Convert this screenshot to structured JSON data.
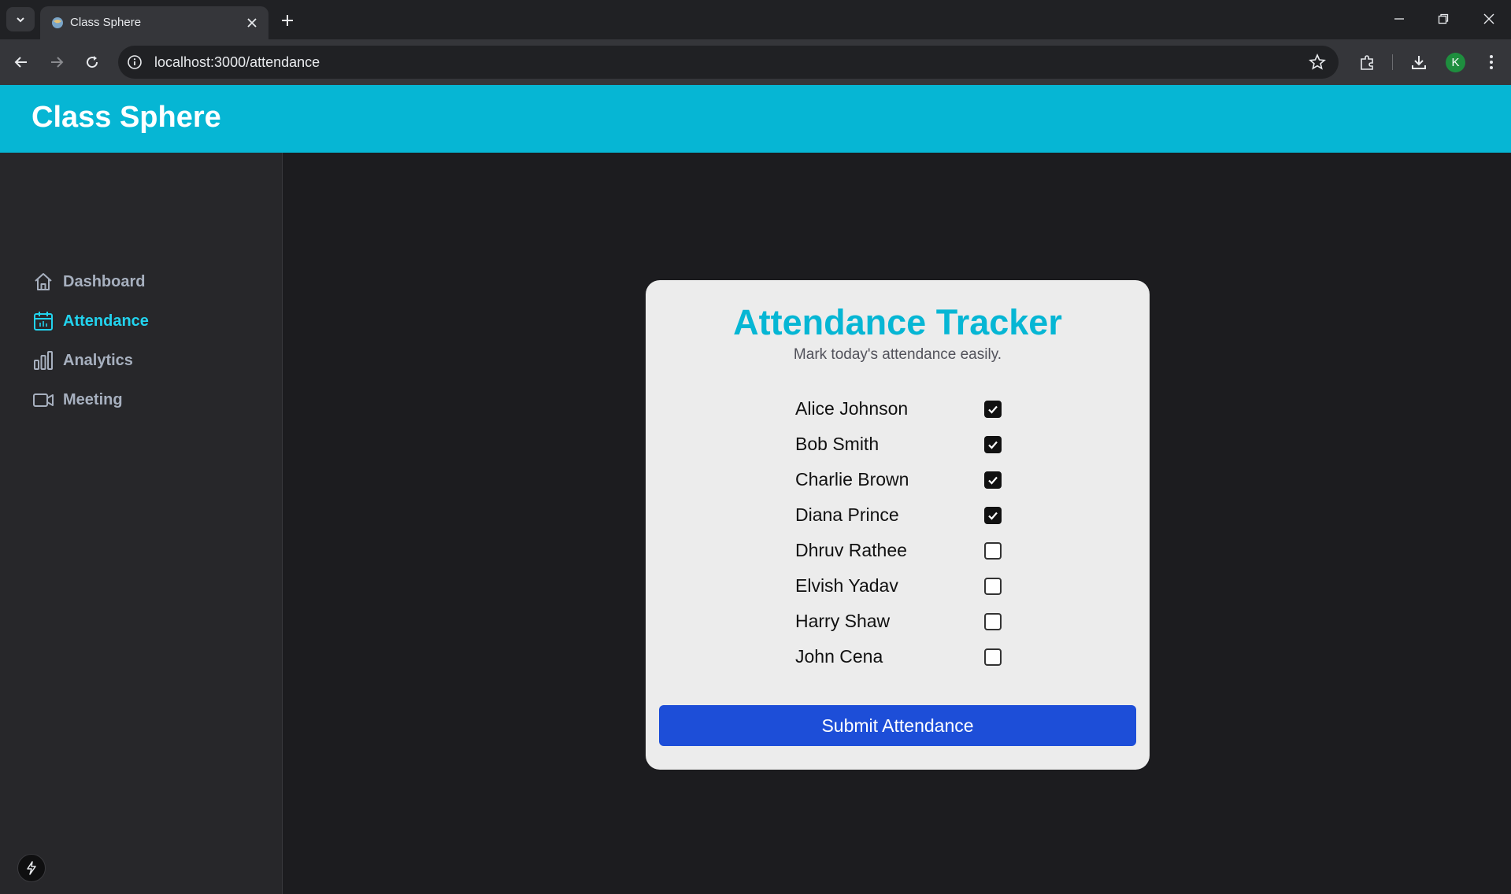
{
  "browser": {
    "tab_title": "Class Sphere",
    "url": "localhost:3000/attendance",
    "profile_initial": "K"
  },
  "app": {
    "title": "Class Sphere",
    "accent_color": "#06b6d4"
  },
  "sidebar": {
    "items": [
      {
        "label": "Dashboard",
        "icon": "home-icon",
        "active": false
      },
      {
        "label": "Attendance",
        "icon": "calendar-icon",
        "active": true
      },
      {
        "label": "Analytics",
        "icon": "bar-chart-icon",
        "active": false
      },
      {
        "label": "Meeting",
        "icon": "video-camera-icon",
        "active": false
      }
    ]
  },
  "tracker": {
    "title": "Attendance Tracker",
    "subtitle": "Mark today's attendance easily.",
    "students": [
      {
        "name": "Alice Johnson",
        "present": true
      },
      {
        "name": "Bob Smith",
        "present": true
      },
      {
        "name": "Charlie Brown",
        "present": true
      },
      {
        "name": "Diana Prince",
        "present": true
      },
      {
        "name": "Dhruv Rathee",
        "present": false
      },
      {
        "name": "Elvish Yadav",
        "present": false
      },
      {
        "name": "Harry Shaw",
        "present": false
      },
      {
        "name": "John Cena",
        "present": false
      }
    ],
    "submit_label": "Submit Attendance",
    "submit_color": "#1d4ed8"
  }
}
